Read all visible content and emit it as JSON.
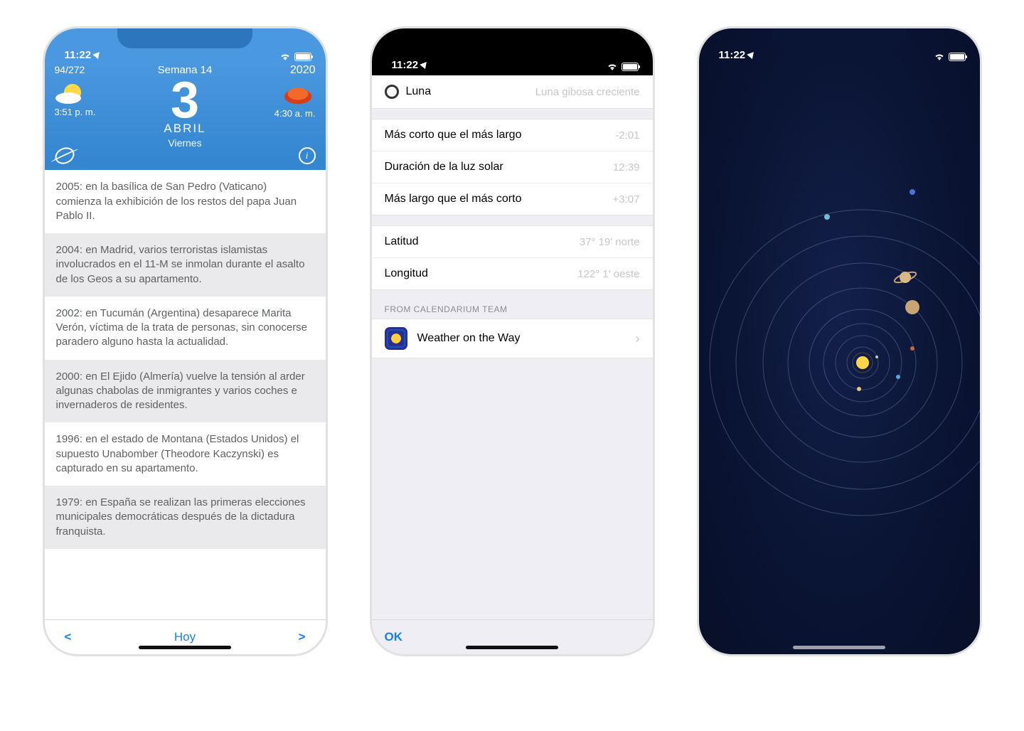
{
  "status_time": "11:22",
  "screen1": {
    "day_count": "94/272",
    "week_label": "Semana 14",
    "year": "2020",
    "day_number": "3",
    "month": "ABRIL",
    "weekday": "Viernes",
    "sunset_time": "3:51 p. m.",
    "sunrise_time": "4:30 a. m.",
    "events": [
      "2005: en la basílica de San Pedro (Vaticano) comienza la exhibición de los restos del papa Juan Pablo II.",
      "2004: en Madrid, varios terroristas islamistas involucrados en el 11-M se inmolan durante el asalto de los Geos a su apartamento.",
      "2002: en Tucumán (Argentina) desaparece Marita Verón, víctima de la trata de personas, sin conocerse paradero alguno hasta la actualidad.",
      "2000: en El Ejido (Almería) vuelve la tensión al arder algunas chabolas de inmigrantes y varios coches e invernaderos de residentes.",
      "1996: en el estado de Montana (Estados Unidos) el supuesto Unabomber (Theodore Kaczynski) es capturado en su apartamento.",
      "1979: en España se realizan las primeras elecciones municipales democráticas después de la dictadura franquista."
    ],
    "nav": {
      "prev": "<",
      "today": "Hoy",
      "next": ">"
    }
  },
  "screen2": {
    "moon": {
      "label": "Luna",
      "phase": "Luna gibosa creciente"
    },
    "rows1": [
      {
        "k": "Más corto que el más largo",
        "v": "-2:01"
      },
      {
        "k": "Duración de la luz solar",
        "v": "12:39"
      },
      {
        "k": "Más largo que el más corto",
        "v": "+3:07"
      }
    ],
    "rows2": [
      {
        "k": "Latitud",
        "v": "37° 19' norte"
      },
      {
        "k": "Longitud",
        "v": "122° 1' oeste"
      }
    ],
    "promo_header": "FROM CALENDARIUM TEAM",
    "promo_app": "Weather on the Way",
    "ok": "OK"
  },
  "screen3": {
    "sun_color": "#ffd54a",
    "orbit_color": "rgba(140,160,210,0.35)"
  }
}
